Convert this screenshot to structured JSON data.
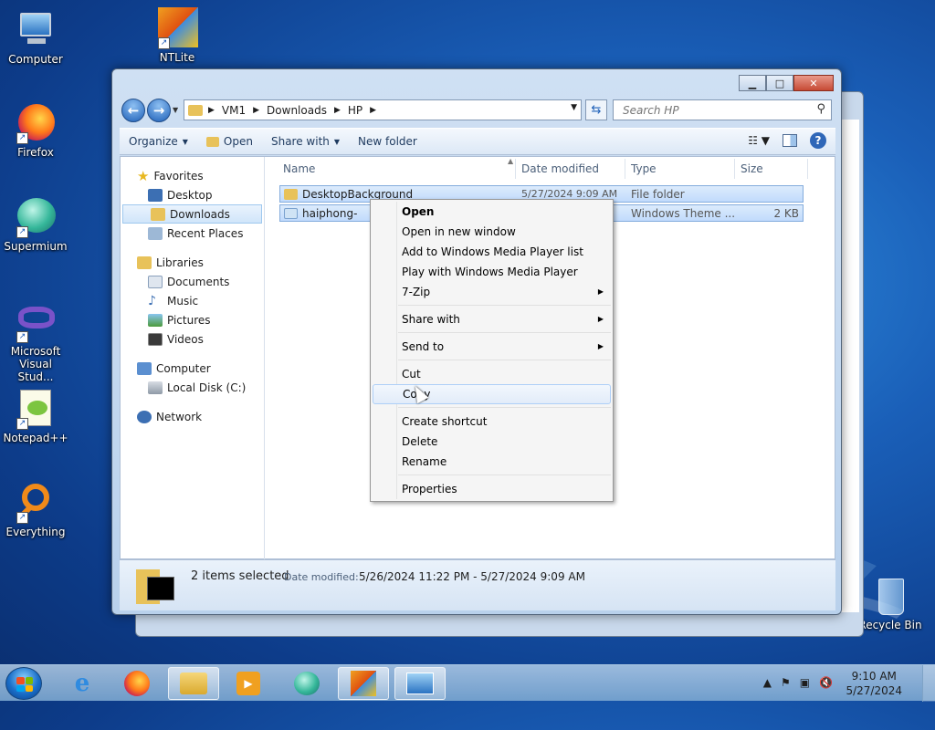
{
  "desktop": {
    "icons": [
      {
        "label": "Computer"
      },
      {
        "label": "NTLite"
      },
      {
        "label": "Firefox"
      },
      {
        "label": "Supermium"
      },
      {
        "label": "Microsoft Visual Stud..."
      },
      {
        "label": "Notepad++"
      },
      {
        "label": "Everything"
      },
      {
        "label": "Recycle Bin"
      }
    ]
  },
  "explorer": {
    "breadcrumb": [
      "VM1",
      "Downloads",
      "HP"
    ],
    "search_placeholder": "Search HP",
    "toolbar": {
      "organize": "Organize",
      "open": "Open",
      "share_with": "Share with",
      "new_folder": "New folder"
    },
    "nav": {
      "favorites": "Favorites",
      "desktop": "Desktop",
      "downloads": "Downloads",
      "recent_places": "Recent Places",
      "libraries": "Libraries",
      "documents": "Documents",
      "music": "Music",
      "pictures": "Pictures",
      "videos": "Videos",
      "computer": "Computer",
      "local_disk": "Local Disk (C:)",
      "network": "Network"
    },
    "columns": {
      "name": "Name",
      "date_modified": "Date modified",
      "type": "Type",
      "size": "Size"
    },
    "files": [
      {
        "name": "DesktopBackground",
        "date": "5/27/2024 9:09 AM",
        "type": "File folder",
        "size": ""
      },
      {
        "name": "haiphong-",
        "date": "",
        "type": "Windows Theme ...",
        "size": "2 KB"
      }
    ],
    "details": {
      "selected": "2 items selected",
      "date_label": "Date modified:",
      "date_range": "5/26/2024 11:22 PM - 5/27/2024 9:09 AM"
    }
  },
  "context_menu": {
    "open": "Open",
    "open_new_window": "Open in new window",
    "add_wmp_list": "Add to Windows Media Player list",
    "play_wmp": "Play with Windows Media Player",
    "seven_zip": "7-Zip",
    "share_with": "Share with",
    "send_to": "Send to",
    "cut": "Cut",
    "copy": "Copy",
    "create_shortcut": "Create shortcut",
    "delete": "Delete",
    "rename": "Rename",
    "properties": "Properties"
  },
  "taskbar": {
    "time": "9:10 AM",
    "date": "5/27/2024"
  },
  "colors": {
    "selection": "#c1dbfc",
    "accent": "#1d5fb8"
  }
}
